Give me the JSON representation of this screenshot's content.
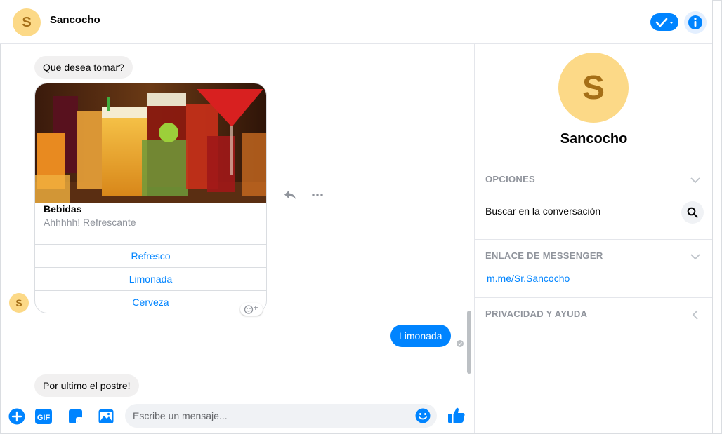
{
  "header": {
    "avatar_letter": "S",
    "contact_name": "Sancocho"
  },
  "chat": {
    "messages": [
      {
        "from": "bot",
        "text": "Que desea tomar?"
      },
      {
        "from": "bot",
        "text": "Por ultimo el postre!"
      }
    ],
    "card": {
      "title": "Bebidas",
      "subtitle": "Ahhhhh! Refrescante",
      "buttons": [
        "Refresco",
        "Limonada",
        "Cerveza"
      ]
    },
    "bot_avatar_letter": "S",
    "user_reply": "Limonada"
  },
  "composer": {
    "gif_label": "GIF",
    "placeholder": "Escribe un mensaje..."
  },
  "panel": {
    "avatar_letter": "S",
    "name": "Sancocho",
    "options_title": "OPCIONES",
    "search_label": "Buscar en la conversación",
    "messenger_link_title": "ENLACE DE MESSENGER",
    "messenger_link": "m.me/Sr.Sancocho",
    "privacy_title": "PRIVACIDAD Y AYUDA"
  },
  "colors": {
    "accent": "#0084ff",
    "avatar_bg": "#fcd987",
    "avatar_fg": "#a56f17",
    "bubble_in": "#f1f0f0"
  }
}
